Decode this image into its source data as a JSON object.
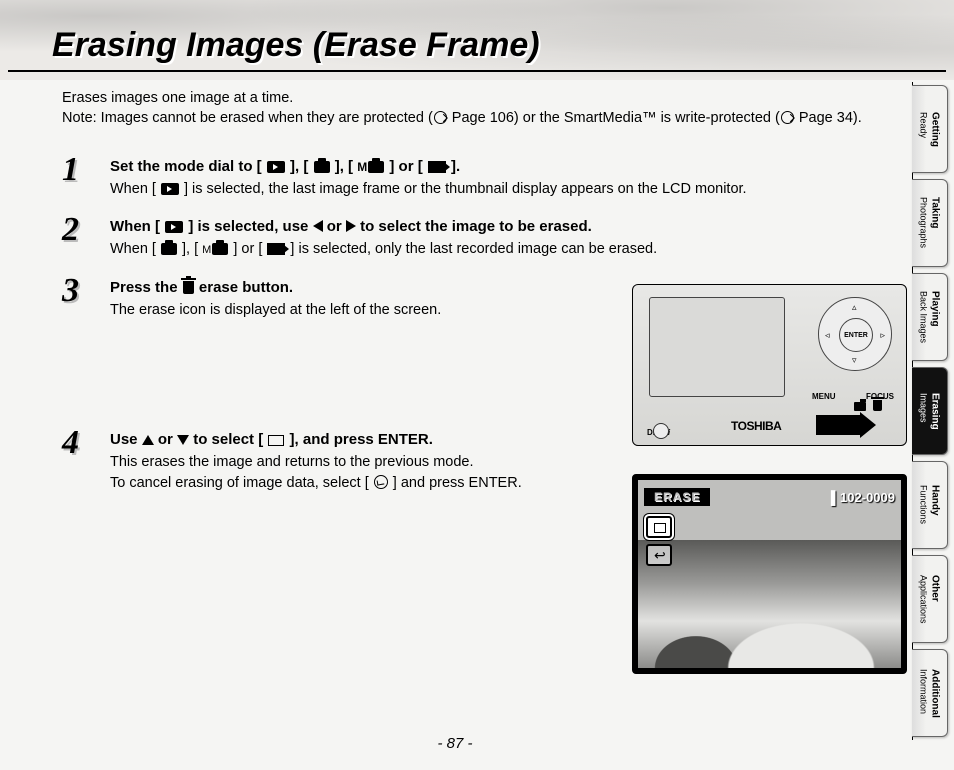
{
  "page_title": "Erasing Images (Erase Frame)",
  "intro_line1": "Erases images one image at a time.",
  "intro_line2_a": "Note: Images cannot be erased when they are protected (",
  "intro_page_ref_1": " Page 106",
  "intro_line2_b": ") or the SmartMedia™ is write-protected (",
  "intro_page_ref_2": " Page 34",
  "intro_line2_c": ").",
  "steps": {
    "s1": {
      "num": "1",
      "head_a": "Set the mode dial to [ ",
      "head_b": " ], [ ",
      "head_c": " ], [ ",
      "head_d": " ] or [ ",
      "head_e": " ].",
      "body_a": "When [ ",
      "body_b": " ] is selected, the last image frame or the thumbnail display appears on the LCD monitor."
    },
    "s2": {
      "num": "2",
      "head_a": "When [ ",
      "head_b": " ] is selected, use ",
      "head_or": " or ",
      "head_c": " to select the image to be erased.",
      "body_a": "When [ ",
      "body_b": " ], [ ",
      "body_c": " ] or [ ",
      "body_d": " ] is selected, only the last recorded image can be erased."
    },
    "s3": {
      "num": "3",
      "head_a": "Press the ",
      "head_b": " erase button.",
      "body": "The erase icon is displayed at the left of the screen."
    },
    "s4": {
      "num": "4",
      "head_a": "Use ",
      "head_or": " or ",
      "head_b": " to select [ ",
      "head_c": " ], and press ENTER.",
      "body1": "This erases the image and returns to the previous mode.",
      "body2_a": "To cancel erasing of image data, select [ ",
      "body2_b": " ] and press ENTER."
    }
  },
  "camera": {
    "enter": "ENTER",
    "menu": "MENU",
    "focus": "FOCUS",
    "disp": "DISP/",
    "brand": "TOSHIBA"
  },
  "lcd": {
    "erase_label": "ERASE",
    "counter": "▌102-0009"
  },
  "page_number": "- 87 -",
  "tabs": [
    {
      "line1": "Getting",
      "line2": "Ready",
      "active": false
    },
    {
      "line1": "Taking",
      "line2": "Photographs",
      "active": false
    },
    {
      "line1": "Playing",
      "line2": "Back Images",
      "active": false
    },
    {
      "line1": "Erasing",
      "line2": "Images",
      "active": true
    },
    {
      "line1": "Handy",
      "line2": "Functions",
      "active": false
    },
    {
      "line1": "Other",
      "line2": "Applications",
      "active": false
    },
    {
      "line1": "Additional",
      "line2": "Information",
      "active": false
    }
  ]
}
